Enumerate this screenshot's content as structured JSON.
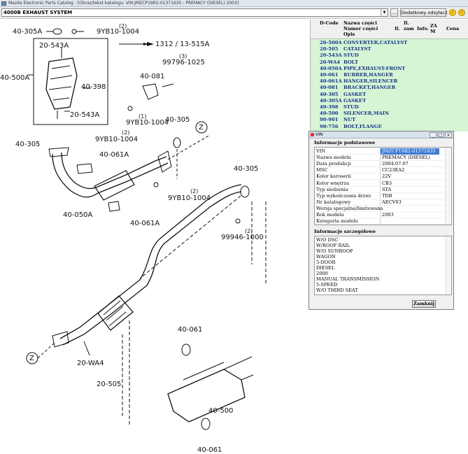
{
  "window_title": "Mazda Electronic Parts Catalog - [Obraz/tekst katalogu: VIN:JMZCP19R2-01371635 - PREMACY (DIESEL) 2003]",
  "toolbar": {
    "combo_value": "4000B  EXHAUST SYSTEM",
    "browse_label": "...",
    "additional_label": "Dodatkowy odsyłacz",
    "back_icon": "arrow-left-icon",
    "forward_icon": "arrow-right-icon"
  },
  "diagram": {
    "callouts": [
      "40-305A",
      "9YB10-1004",
      "(2)",
      "1312 / 13-515A",
      "20-543A",
      "99796-1025",
      "(3)",
      "40-500A",
      "40-081",
      "40-398",
      "20-543A",
      "(1)",
      "9YB10-1004",
      "40-305",
      "Z",
      "40-305",
      "9YB10-1004",
      "(2)",
      "40-061A",
      "40-050A",
      "9YB10-1004",
      "(2)",
      "40-061A",
      "40-305",
      "99946-1000",
      "(2)",
      "20-WA4",
      "20-505",
      "Z",
      "40-061",
      "40-500",
      "40-061"
    ]
  },
  "parts_table": {
    "headers": {
      "dcode": "D-Code",
      "name": "Nazwa części",
      "number": "Numer części",
      "desc": "Opis",
      "qty": "Il.",
      "qty_ord": "Il. zam",
      "info": "Info.",
      "zam": "ZA M",
      "price": "Cena"
    },
    "rows": [
      {
        "code": "20-500A",
        "name": "CONVERTER,CATALYST"
      },
      {
        "code": "20-505",
        "name": "CATALYST"
      },
      {
        "code": "20-543A",
        "name": "STUD"
      },
      {
        "code": "20-WA4",
        "name": "BOLT"
      },
      {
        "code": "40-050A",
        "name": "PIPE,EXHAUST-FRONT"
      },
      {
        "code": "40-061",
        "name": "RUBBER,HANGER"
      },
      {
        "code": "40-061A",
        "name": "HANGER,SILENCER"
      },
      {
        "code": "40-081",
        "name": "BRACKET,HANGER"
      },
      {
        "code": "40-305",
        "name": "GASKET"
      },
      {
        "code": "40-305A",
        "name": "GASKET"
      },
      {
        "code": "40-398",
        "name": "STUD"
      },
      {
        "code": "40-500",
        "name": "SILENCER,MAIN"
      },
      {
        "code": "90-901",
        "name": "NUT"
      },
      {
        "code": "90-756",
        "name": "BOLT,FLANGE"
      }
    ]
  },
  "vin_window": {
    "title": "VIN",
    "basic_info_label": "Informacje podstawowe",
    "rows": [
      {
        "k": "VIN",
        "v": "JMZCP19R2-01371635"
      },
      {
        "k": "Nazwa modelu",
        "v": "PREMACY (DIESEL)"
      },
      {
        "k": "Data produkcji",
        "v": "2004.07.07"
      },
      {
        "k": "MSC",
        "v": "CC23EA2"
      },
      {
        "k": "Kolor karoserii",
        "v": "22V"
      },
      {
        "k": "Kolor wnętrza",
        "v": "CB3"
      },
      {
        "k": "Typ siedzenia",
        "v": "STA"
      },
      {
        "k": "Typ wykończenia drzwi",
        "v": "TDB"
      },
      {
        "k": "Nr katalogowy",
        "v": "AECV03"
      },
      {
        "k": "Wersja specjalna/limitowana",
        "v": ""
      },
      {
        "k": "Rok modelu",
        "v": "2003"
      },
      {
        "k": "Kategoria modelu",
        "v": ""
      }
    ],
    "details_label": "Informacje szczegółowe",
    "details": [
      "W/O DSC",
      "W/ROOF RAIL",
      "W/O SUNROOF",
      "WAGON",
      "5-DOOR",
      "DIESEL",
      "2000",
      "MANUAL TRANSMISSION",
      "5-SPEED",
      "W/O THIRD SEAT"
    ],
    "close_label": "Zamknij"
  }
}
